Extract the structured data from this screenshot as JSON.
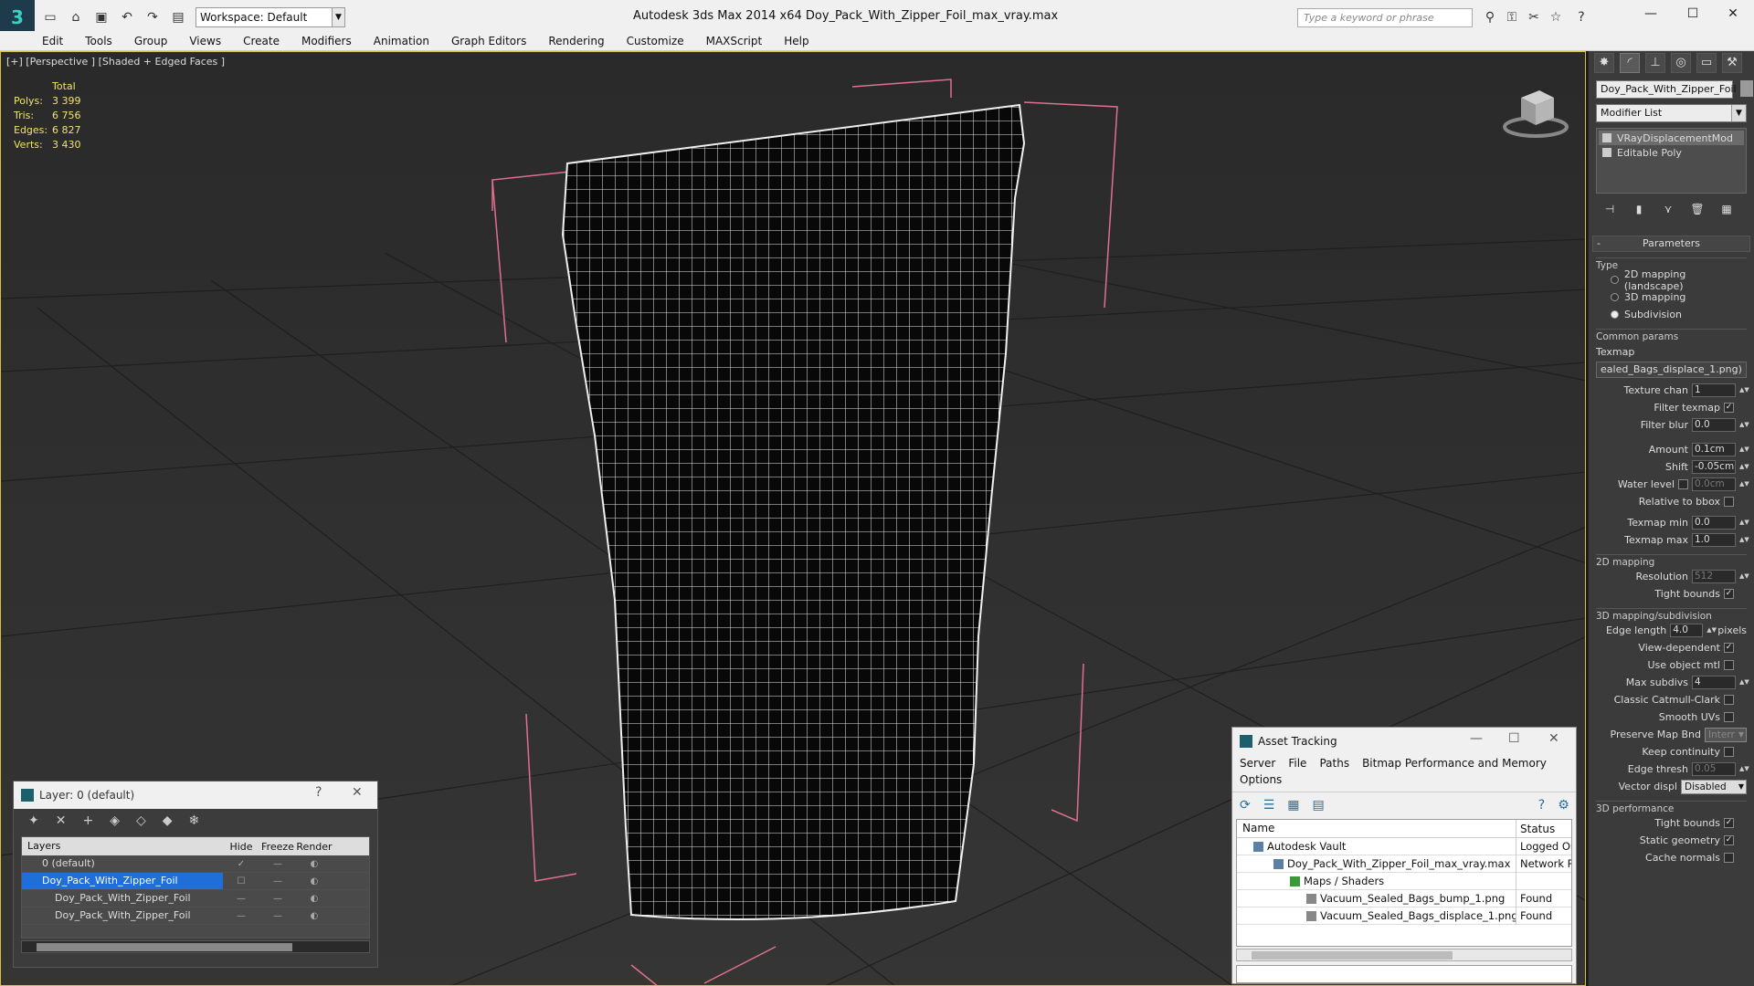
{
  "app": {
    "title": "Autodesk 3ds Max  2014 x64     Doy_Pack_With_Zipper_Foil_max_vray.max",
    "workspace": "Workspace: Default",
    "search_placeholder": "Type a keyword or phrase"
  },
  "menu": [
    "Edit",
    "Tools",
    "Group",
    "Views",
    "Create",
    "Modifiers",
    "Animation",
    "Graph Editors",
    "Rendering",
    "Customize",
    "MAXScript",
    "Help"
  ],
  "viewport": {
    "label": "[+] [Perspective ] [Shaded + Edged Faces ]",
    "stats": {
      "header": "Total",
      "rows": [
        {
          "label": "Polys:",
          "value": "3 399"
        },
        {
          "label": "Tris:",
          "value": "6 756"
        },
        {
          "label": "Edges:",
          "value": "6 827"
        },
        {
          "label": "Verts:",
          "value": "3 430"
        }
      ]
    }
  },
  "command_panel": {
    "object_name": "Doy_Pack_With_Zipper_Foil",
    "modifier_list": "Modifier List",
    "stack": [
      "VRayDisplacementMod",
      "Editable Poly"
    ],
    "rollout": "Parameters",
    "type_label": "Type",
    "type_options": [
      "2D mapping (landscape)",
      "3D mapping",
      "Subdivision"
    ],
    "common_params": "Common params",
    "texmap_label": "Texmap",
    "texmap_value": "ealed_Bags_displace_1.png)",
    "texture_chan": {
      "label": "Texture chan",
      "value": "1"
    },
    "filter_texmap": "Filter texmap",
    "filter_blur": {
      "label": "Filter blur",
      "value": "0.0"
    },
    "amount": {
      "label": "Amount",
      "value": "0.1cm"
    },
    "shift": {
      "label": "Shift",
      "value": "-0.05cm"
    },
    "water_level": {
      "label": "Water level",
      "value": "0.0cm"
    },
    "relative_bbox": "Relative to bbox",
    "texmap_min": {
      "label": "Texmap min",
      "value": "0.0"
    },
    "texmap_max": {
      "label": "Texmap max",
      "value": "1.0"
    },
    "mapping_2d": "2D mapping",
    "resolution": {
      "label": "Resolution",
      "value": "512"
    },
    "tight_bounds_2d": "Tight bounds",
    "mapping_3d": "3D mapping/subdivision",
    "edge_length": {
      "label": "Edge length",
      "value": "4.0",
      "unit": "pixels"
    },
    "view_dependent": "View-dependent",
    "use_object_mtl": "Use object mtl",
    "max_subdivs": {
      "label": "Max subdivs",
      "value": "4"
    },
    "catmull": "Classic Catmull-Clark",
    "smooth_uvs": "Smooth UVs",
    "preserve_map": {
      "label": "Preserve Map Bnd",
      "value": "Interr"
    },
    "keep_continuity": "Keep continuity",
    "edge_thresh": {
      "label": "Edge thresh",
      "value": "0.05"
    },
    "vector_displ": {
      "label": "Vector displ",
      "value": "Disabled"
    },
    "perf": "3D performance",
    "tight_bounds": "Tight bounds",
    "static_geometry": "Static geometry",
    "cache_normals": "Cache normals"
  },
  "layer_dialog": {
    "title": "Layer: 0 (default)",
    "help": "?",
    "columns": [
      "Layers",
      "Hide",
      "Freeze",
      "Render"
    ],
    "rows": [
      "0 (default)",
      "Doy_Pack_With_Zipper_Foil",
      "Doy_Pack_With_Zipper_Foil",
      "Doy_Pack_With_Zipper_Foil"
    ]
  },
  "asset_dialog": {
    "title": "Asset Tracking",
    "menu": [
      "Server",
      "File",
      "Paths",
      "Bitmap Performance and Memory"
    ],
    "menu2": "Options",
    "columns": [
      "Name",
      "Status"
    ],
    "rows": [
      {
        "name": "Autodesk Vault",
        "status": "Logged Ou"
      },
      {
        "name": "Doy_Pack_With_Zipper_Foil_max_vray.max",
        "status": "Network P"
      },
      {
        "name": "Maps / Shaders",
        "status": ""
      },
      {
        "name": "Vacuum_Sealed_Bags_bump_1.png",
        "status": "Found"
      },
      {
        "name": "Vacuum_Sealed_Bags_displace_1.png",
        "status": "Found"
      }
    ]
  },
  "colors": {
    "stats": "#f1e36b",
    "bbox": "#e07090",
    "selection": "#1e6fd9"
  }
}
